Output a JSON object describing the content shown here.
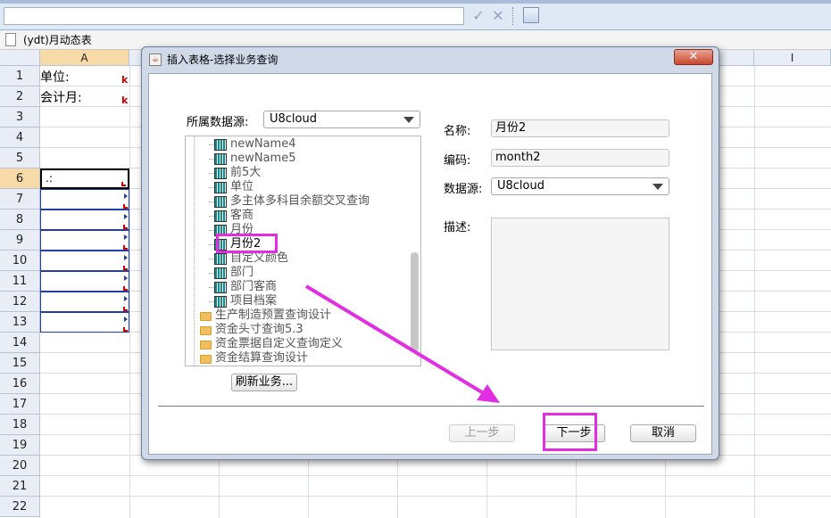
{
  "document": {
    "title": "(ydt)月动态表"
  },
  "toolbar": {
    "confirm_icon": "check-icon",
    "cancel_icon": "x-icon",
    "image_icon": "insert-image-icon"
  },
  "sheet": {
    "columns": [
      "A",
      "I"
    ],
    "rows": [
      "1",
      "2",
      "3",
      "4",
      "5",
      "6",
      "7",
      "8",
      "9",
      "10",
      "11",
      "12",
      "13",
      "14",
      "15",
      "16",
      "17",
      "18",
      "19",
      "20",
      "21",
      "22"
    ],
    "cells": {
      "a1": "单位:",
      "a2": "会计月:",
      "a6": ".:",
      "mark": "k"
    }
  },
  "dialog": {
    "title": "插入表格-选择业务查询",
    "datasource_label": "所属数据源:",
    "datasource_value": "U8cloud",
    "tree_leaves": [
      "newName4",
      "newName5",
      "前5大",
      "单位",
      "多主体多科目余额交叉查询",
      "客商",
      "月份",
      "月份2",
      "自定义颜色",
      "部门",
      "部门客商",
      "项目档案"
    ],
    "tree_folders": [
      "生产制造预置查询设计",
      "资金头寸查询5.3",
      "资金票据自定义查询定义",
      "资金结算查询设计"
    ],
    "refresh_label": "刷新业务...",
    "name_label": "名称:",
    "name_value": "月份2",
    "code_label": "编码:",
    "code_value": "month2",
    "source_label": "数据源:",
    "source_value": "U8cloud",
    "desc_label": "描述:",
    "prev_label": "上一步",
    "next_label": "下一步",
    "cancel_label": "取消"
  },
  "colors": {
    "highlight": "#e22ee2",
    "selected_header": "#f8d9a8",
    "marker_red": "#d00000"
  }
}
